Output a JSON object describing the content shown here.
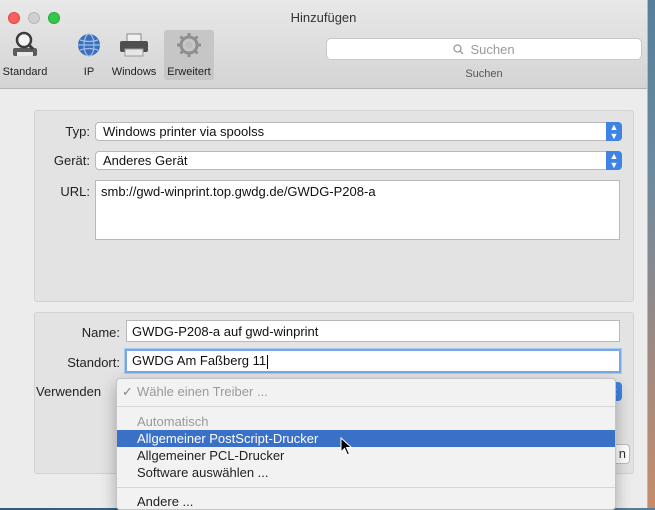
{
  "window": {
    "title": "Hinzufügen"
  },
  "toolbar": {
    "items": [
      {
        "label": "Standard",
        "icon": "magnifier-printer-icon"
      },
      {
        "label": "IP",
        "icon": "globe-icon"
      },
      {
        "label": "Windows",
        "icon": "printer-icon"
      },
      {
        "label": "Erweitert",
        "icon": "gear-icon",
        "selected": true
      }
    ],
    "search": {
      "placeholder": "Suchen",
      "caption": "Suchen"
    }
  },
  "form": {
    "typ": {
      "label": "Typ:",
      "value": "Windows printer via spoolss"
    },
    "geraet": {
      "label": "Gerät:",
      "value": "Anderes Gerät"
    },
    "url": {
      "label": "URL:",
      "value": "smb://gwd-winprint.top.gwdg.de/GWDG-P208-a"
    },
    "name": {
      "label": "Name:",
      "value": "GWDG-P208-a auf gwd-winprint"
    },
    "standort": {
      "label": "Standort:",
      "value": "GWDG Am Faßberg 11"
    },
    "verwenden": {
      "label": "Verwenden"
    }
  },
  "add_button": {
    "label": "Hinzufügen",
    "visible_fragment": "n"
  },
  "driver_menu": {
    "check_item": "Wähle einen Treiber ...",
    "section_header": "Automatisch",
    "items": [
      {
        "label": "Allgemeiner PostScript-Drucker",
        "selected": true
      },
      {
        "label": "Allgemeiner PCL-Drucker"
      },
      {
        "label": "Software auswählen ..."
      }
    ],
    "other": "Andere ..."
  },
  "colors": {
    "accent": "#3f84e5",
    "menu_highlight": "#3a70c6"
  }
}
